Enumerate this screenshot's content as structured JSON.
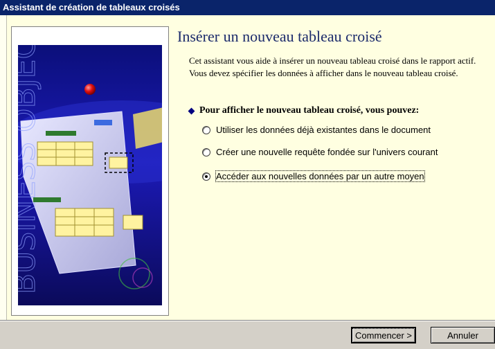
{
  "window": {
    "title": "Assistant de création de tableaux croisés"
  },
  "main": {
    "heading": "Insérer un nouveau tableau croisé",
    "description": "Cet assistant vous aide à insérer un nouveau tableau croisé dans le rapport actif. Vous devez spécifier les données à afficher dans le nouveau tableau croisé.",
    "prompt": "Pour afficher le nouveau tableau croisé, vous pouvez:",
    "options": [
      {
        "label": "Utiliser les données déjà existantes dans le document",
        "selected": false
      },
      {
        "label": "Créer une nouvelle requête fondée sur l'univers courant",
        "selected": false
      },
      {
        "label": "Accéder aux nouvelles données par un autre moyen",
        "selected": true
      }
    ]
  },
  "illustration": {
    "watermark": "BUSINESS OBJECTS"
  },
  "buttons": {
    "start": "Commencer >",
    "cancel": "Annuler"
  },
  "colors": {
    "titlebar": "#0a246a",
    "client": "#ffffe1",
    "heading": "#1b2a6b"
  }
}
